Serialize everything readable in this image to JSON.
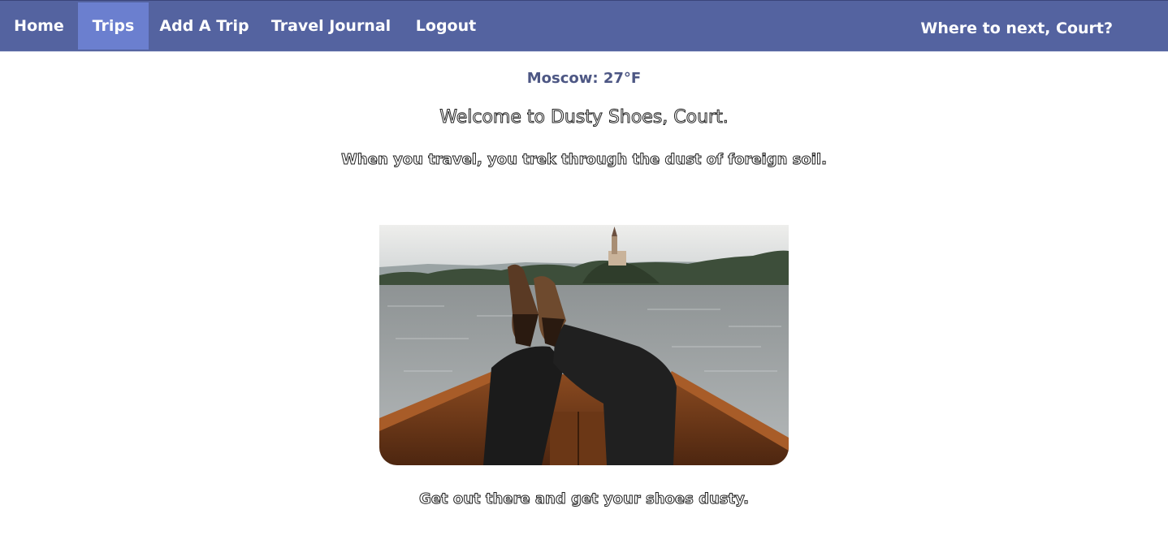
{
  "nav": {
    "items": [
      {
        "label": "Home",
        "active": false
      },
      {
        "label": "Trips",
        "active": true
      },
      {
        "label": "Add A Trip",
        "active": false
      },
      {
        "label": "Travel Journal",
        "active": false
      },
      {
        "label": "Logout",
        "active": false
      }
    ],
    "greeting": "Where to next, Court?"
  },
  "weather": {
    "text": "Moscow: 27°F"
  },
  "welcome": {
    "heading": "Welcome to Dusty Shoes, Court.",
    "tagline": "When you travel, you trek through the dust of foreign soil."
  },
  "hero": {
    "image_description_icon": "boat-lake-photo"
  },
  "footer": {
    "tagline": "Get out there and get your shoes dusty."
  },
  "colors": {
    "navbar": "#5463a0",
    "nav_active": "#6b7fcf",
    "weather_text": "#4d5784"
  }
}
